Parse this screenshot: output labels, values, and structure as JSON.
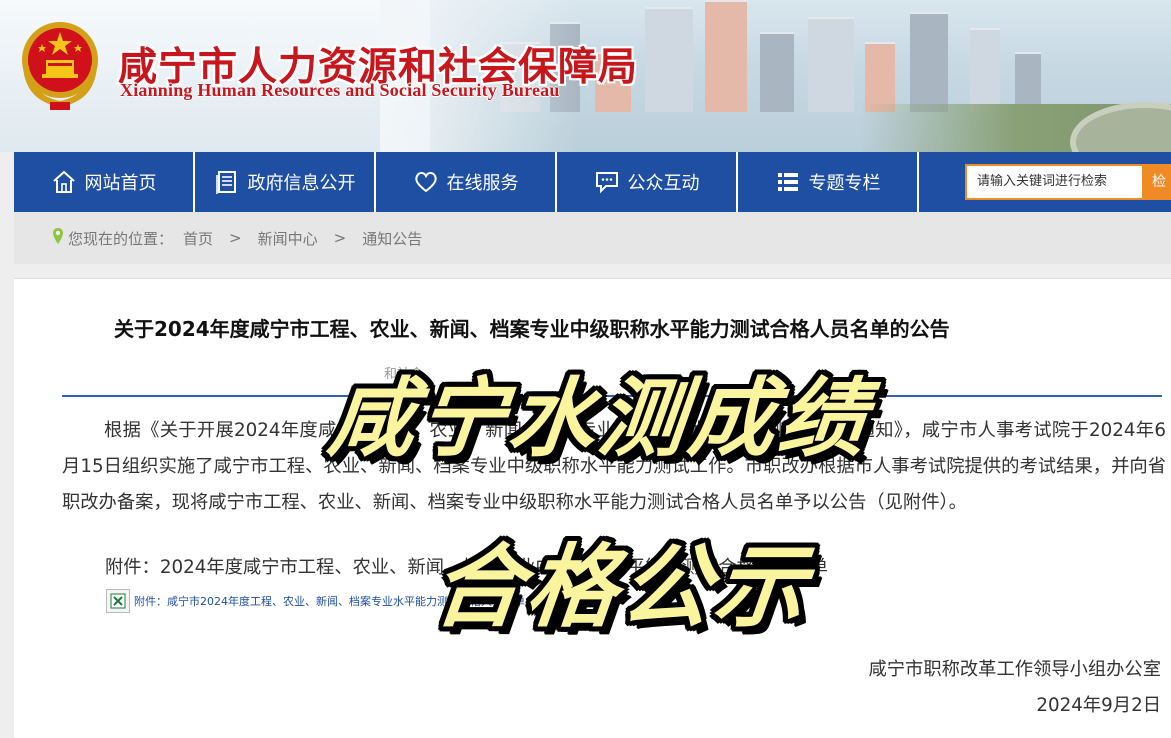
{
  "header": {
    "title": "咸宁市人力资源和社会保障局",
    "subtitle": "Xianning Human Resources and Social Security Bureau"
  },
  "nav": {
    "items": [
      {
        "label": "网站首页",
        "icon": "home-icon"
      },
      {
        "label": "政府信息公开",
        "icon": "document-icon"
      },
      {
        "label": "在线服务",
        "icon": "heart-icon"
      },
      {
        "label": "公众互动",
        "icon": "chat-icon"
      },
      {
        "label": "专题专栏",
        "icon": "list-icon"
      }
    ],
    "search_placeholder": "请输入关键词进行检索",
    "search_button": "检"
  },
  "breadcrumb": {
    "prefix": "您现在的位置：",
    "items": [
      "首页",
      "新闻中心",
      "通知公告"
    ],
    "separator": ">"
  },
  "article": {
    "title": "关于2024年度咸宁市工程、农业、新闻、档案专业中级职称水平能力测试合格人员名单的公告",
    "meta_fragment": "和社会",
    "body": "根据《关于开展2024年度咸宁市工程、农业、新闻、档案专业中级职称水平能力测试工作的通知》，咸宁市人事考试院于2024年6月15日组织实施了咸宁市工程、农业、新闻、档案专业中级职称水平能力测试工作。市职改办根据市人事考试院提供的考试结果，并向省职改办备案，现将咸宁市工程、农业、新闻、档案专业中级职称水平能力测试合格人员名单予以公告（见附件）。",
    "attachment_line": "附件：2024年度咸宁市工程、农业、新闻、档案专业中级职称水平能力测试合格人员名单",
    "attachment_file": "附件：咸宁市2024年度工程、农业、新闻、档案专业水平能力测试合格人员名单.xls",
    "signature": "咸宁市职称改革工作领导小组办公室",
    "date": "2024年9月2日"
  },
  "overlay": {
    "line1": "咸宁水测成绩",
    "line2": "合格公示"
  },
  "colors": {
    "nav_bg": "#1e4fa3",
    "title_red": "#c8161d",
    "search_orange": "#f08a24",
    "overlay_fill": "#fbf49f"
  }
}
